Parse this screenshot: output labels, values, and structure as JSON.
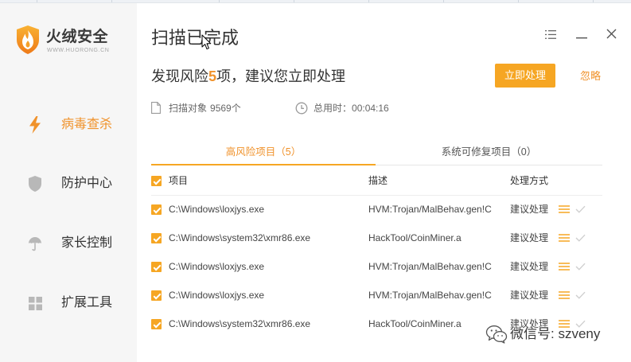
{
  "colors": {
    "accent": "#f6a623",
    "accent_text": "#f0922b",
    "sidebar_bg": "#f6f6f6",
    "text": "#333333",
    "muted": "#666666",
    "icon_gray": "#b8b8b8"
  },
  "logo": {
    "icon": "flame-shield-icon",
    "name": "火绒安全",
    "tagline": "WWW.HUORONG.CN"
  },
  "window_controls": {
    "menu_icon": "menu-icon",
    "minimize_icon": "minimize-icon",
    "close_icon": "close-icon"
  },
  "sidebar": {
    "items": [
      {
        "label": "病毒查杀",
        "icon": "lightning-icon",
        "active": true
      },
      {
        "label": "防护中心",
        "icon": "shield-icon",
        "active": false
      },
      {
        "label": "家长控制",
        "icon": "umbrella-icon",
        "active": false
      },
      {
        "label": "扩展工具",
        "icon": "grid-icon",
        "active": false
      }
    ]
  },
  "main": {
    "title": "扫描已完成",
    "summary": {
      "prefix": "发现风险",
      "count": "5",
      "suffix": "项，建议您立即处理"
    },
    "primary_button": "立即处理",
    "ignore_link": "忽略",
    "stats": {
      "scanned": {
        "icon": "document-icon",
        "label": "扫描对象",
        "value": "9569个"
      },
      "elapsed": {
        "icon": "clock-icon",
        "label": "总用时：",
        "value": "00:04:16"
      }
    },
    "tabs": [
      {
        "label": "高风险项目（5）",
        "active": true
      },
      {
        "label": "系统可修复项目（0）",
        "active": false
      }
    ],
    "table": {
      "select_all_checked": true,
      "columns": [
        "项目",
        "描述",
        "处理方式"
      ],
      "rows": [
        {
          "checked": true,
          "path": "C:\\Windows\\loxjys.exe",
          "description": "HVM:Trojan/MalBehav.gen!C",
          "action": "建议处理"
        },
        {
          "checked": true,
          "path": "C:\\Windows\\system32\\xmr86.exe",
          "description": "HackTool/CoinMiner.a",
          "action": "建议处理"
        },
        {
          "checked": true,
          "path": "C:\\Windows\\loxjys.exe",
          "description": "HVM:Trojan/MalBehav.gen!C",
          "action": "建议处理"
        },
        {
          "checked": true,
          "path": "C:\\Windows\\loxjys.exe",
          "description": "HVM:Trojan/MalBehav.gen!C",
          "action": "建议处理"
        },
        {
          "checked": true,
          "path": "C:\\Windows\\system32\\xmr86.exe",
          "description": "HackTool/CoinMiner.a",
          "action": "建议处理"
        }
      ]
    }
  },
  "watermark": {
    "icon": "wechat-icon",
    "text": "微信号: szveny"
  }
}
